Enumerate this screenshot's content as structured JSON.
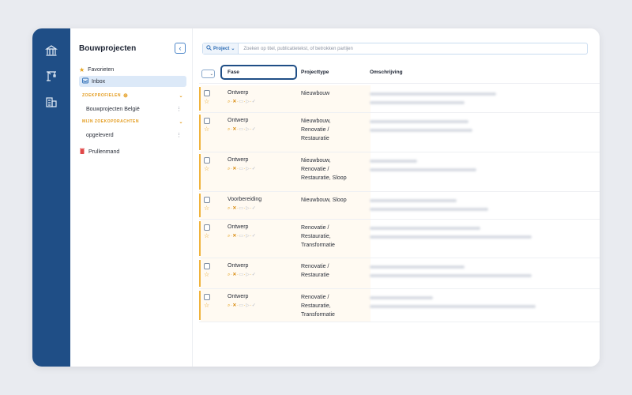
{
  "sidebar": {
    "title": "Bouwprojecten",
    "collapse_label": "‹",
    "favorites": "Favorieten",
    "inbox": "Inbox",
    "profiles_heading": "ZOEKPROFIELEN",
    "profile_item": "Bouwprojecten België",
    "my_search_heading": "MIJN ZOEKOPDRACHTEN",
    "my_search_item": "opgeleverd",
    "trash": "Prullenmand"
  },
  "search": {
    "scope": "Project",
    "placeholder": "Zoeken op titel, publicatietekst, of betrokken partijen"
  },
  "table": {
    "headers": {
      "fase": "Fase",
      "projecttype": "Projecttype",
      "omschrijving": "Omschrijving"
    },
    "rows": [
      {
        "phase": "Ontwerp",
        "projecttype": [
          "Nieuwbouw"
        ]
      },
      {
        "phase": "Ontwerp",
        "projecttype": [
          "Nieuwbouw,",
          "Renovatie /",
          "Restauratie"
        ]
      },
      {
        "phase": "Ontwerp",
        "projecttype": [
          "Nieuwbouw,",
          "Renovatie /",
          "Restauratie, Sloop"
        ]
      },
      {
        "phase": "Voorbereiding",
        "projecttype": [
          "Nieuwbouw, Sloop"
        ]
      },
      {
        "phase": "Ontwerp",
        "projecttype": [
          "Renovatie /",
          "Restauratie,",
          "Transformatie"
        ]
      },
      {
        "phase": "Ontwerp",
        "projecttype": [
          "Renovatie /",
          "Restauratie"
        ]
      },
      {
        "phase": "Ontwerp",
        "projecttype": [
          "Renovatie /",
          "Restauratie,",
          "Transformatie"
        ]
      }
    ]
  },
  "colors": {
    "rail": "#1f4e86",
    "accent": "#e5a21d",
    "link": "#2d6db5"
  },
  "icons": [
    "building-icon",
    "crane-icon",
    "office-icon",
    "star-icon",
    "inbox-icon",
    "trash-icon",
    "search-icon"
  ]
}
